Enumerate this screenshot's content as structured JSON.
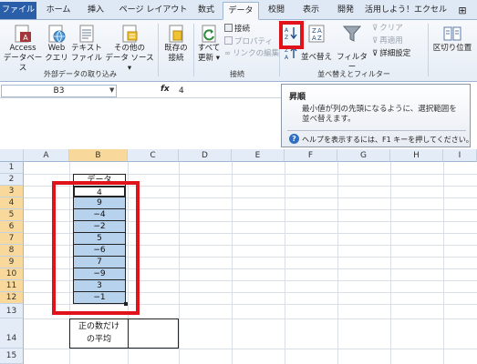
{
  "tabs": [
    {
      "label": "ファイル"
    },
    {
      "label": "ホーム"
    },
    {
      "label": "挿入"
    },
    {
      "label": "ページ レイアウト"
    },
    {
      "label": "数式"
    },
    {
      "label": "データ"
    },
    {
      "label": "校閲"
    },
    {
      "label": "表示"
    },
    {
      "label": "開発"
    },
    {
      "label": "活用しよう！エクセル"
    }
  ],
  "ribbon": {
    "access": {
      "l1": "Access",
      "l2": "データベース"
    },
    "web": {
      "l1": "Web",
      "l2": "クエリ"
    },
    "text": {
      "l1": "テキスト",
      "l2": "ファイル"
    },
    "other": {
      "l1": "その他の",
      "l2": "データ ソース ▾"
    },
    "existing": {
      "l1": "既存の",
      "l2": "接続"
    },
    "refresh": {
      "l1": "すべて",
      "l2": "更新 ▾"
    },
    "connect": "接続",
    "properties": "プロパティ",
    "editlinks": "リンクの編集",
    "sort": "並べ替え",
    "filter": "フィルター",
    "clear": "クリア",
    "reapply": "再適用",
    "advanced": "詳細設定",
    "split": "区切り位置",
    "group_external": "外部データの取り込み",
    "group_connect": "接続",
    "group_sort": "並べ替えとフィルター"
  },
  "formula_bar": {
    "name_box": "B3",
    "fx": "fx",
    "value": "4"
  },
  "tooltip": {
    "title": "昇順",
    "desc": "最小値が列の先頭になるように、選択範囲を並べ替えます。",
    "help": "ヘルプを表示するには、F1 キーを押してください。"
  },
  "columns": [
    "A",
    "B",
    "C",
    "D",
    "E",
    "F",
    "G",
    "H",
    "I"
  ],
  "rows": [
    "1",
    "2",
    "3",
    "4",
    "5",
    "6",
    "7",
    "8",
    "9",
    "10",
    "11",
    "12",
    "13",
    "14",
    "15"
  ],
  "cells": {
    "b2": "データ",
    "values": [
      "4",
      "9",
      "−4",
      "−2",
      "5",
      "−6",
      "7",
      "−9",
      "3",
      "−1"
    ],
    "b14_l1": "正の数だけ",
    "b14_l2": "の平均"
  },
  "colors": {
    "accent_red": "#e0131b",
    "selection": "#b7d2ec",
    "file_tab": "#2a5ea8"
  }
}
